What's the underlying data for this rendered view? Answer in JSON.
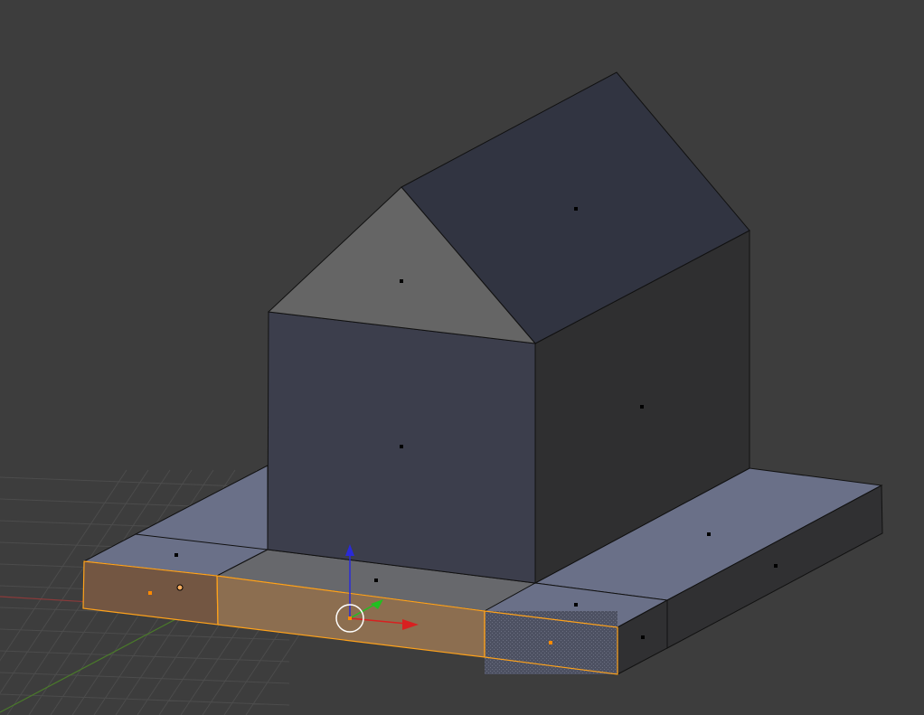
{
  "viewport": {
    "background": "#3d3d3d",
    "grid_color": "#4c4c4c",
    "x_axis_color": "#8a3a3a",
    "y_axis_color": "#4a7a2a"
  },
  "mesh": {
    "edge_color": "#111111",
    "face_colors": {
      "roof_right": "#313441",
      "roof_gable": "#656565",
      "wall_front": "#3c3e4c",
      "wall_right": "#2f2f30",
      "base_top": "#6a7088",
      "base_top_faded": "#67686c",
      "base_side_dark": "#303032",
      "base_front": "#6c6f7e"
    },
    "selection": {
      "edge_color": "#ffa21a",
      "face_fill": "#8c6e50",
      "face_fill_dark": "#735642",
      "face_hatched": "#4d5162"
    }
  },
  "gizmo": {
    "z_color": "#2a2ad8",
    "y_color": "#20c020",
    "x_color": "#d82020",
    "cursor_color": "#ffffff"
  }
}
